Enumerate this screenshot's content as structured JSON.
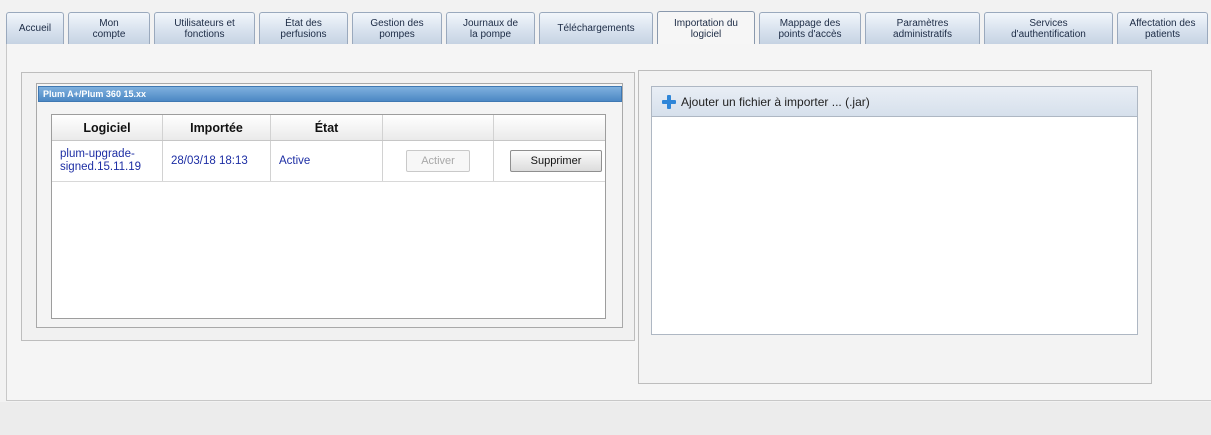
{
  "tabs": [
    {
      "label": "Accueil",
      "active": false
    },
    {
      "label": "Mon\ncompte",
      "active": false
    },
    {
      "label": "Utilisateurs et\nfonctions",
      "active": false
    },
    {
      "label": "État des\nperfusions",
      "active": false
    },
    {
      "label": "Gestion des\npompes",
      "active": false
    },
    {
      "label": "Journaux de\nla pompe",
      "active": false
    },
    {
      "label": "Téléchargements",
      "active": false
    },
    {
      "label": "Importation du\nlogiciel",
      "active": true
    },
    {
      "label": "Mappage des\npoints d'accès",
      "active": false
    },
    {
      "label": "Paramètres\nadministratifs",
      "active": false
    },
    {
      "label": "Services\nd'authentification",
      "active": false
    },
    {
      "label": "Affectation des\npatients",
      "active": false
    }
  ],
  "panel": {
    "title": "Plum A+/Plum 360 15.xx",
    "columns": [
      "Logiciel",
      "Importée",
      "État",
      "",
      ""
    ],
    "rows": [
      {
        "software": "plum-upgrade-\nsigned.15.11.19",
        "imported": "28/03/18 18:13",
        "status": "Active",
        "activate_label": "Activer",
        "delete_label": "Supprimer"
      }
    ]
  },
  "import": {
    "add_label": "Ajouter un fichier à importer ... (.jar)",
    "icon": "plus-icon"
  },
  "colors": {
    "tab_bg": "#d8e2ee",
    "panel_title_bg": "#4c88c4",
    "link_text": "#1d2ea4",
    "plus_icon": "#2f86d8"
  }
}
